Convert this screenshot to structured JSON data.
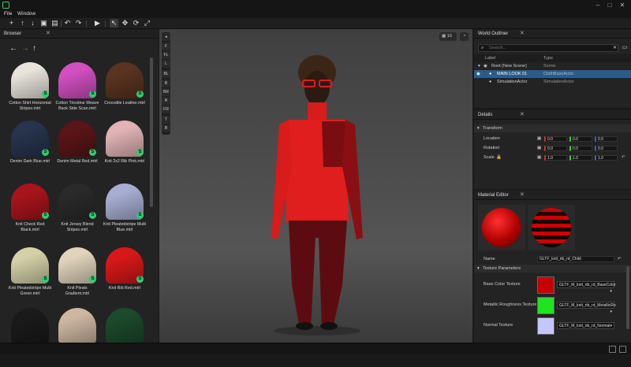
{
  "menu": {
    "file": "File",
    "window": "Window"
  },
  "browser": {
    "tab_label": "Browser",
    "items": [
      {
        "label": "Cotton Shirt Horizontal Stripes.mtrl",
        "color": "#e8e4dc"
      },
      {
        "label": "Cotton Tricotine Weave Back Side Scan.mtrl",
        "color": "#d24fc1"
      },
      {
        "label": "Crocodile Leather.mtrl",
        "color": "#5a3420"
      },
      {
        "label": "Denim Dark Blue.mtrl",
        "color": "#26344e"
      },
      {
        "label": "Denim Metal Red.mtrl",
        "color": "#5a1518"
      },
      {
        "label": "Knit 2x2 Rib Pink.mtrl",
        "color": "#e2b3b6"
      },
      {
        "label": "Knit Check Red Black.mtrl",
        "color": "#a8141c"
      },
      {
        "label": "Knit Jersey Blend Stripes.mtrl",
        "color": "#2a2a2a"
      },
      {
        "label": "Knit Pleatedstripe Multi Blue.mtrl",
        "color": "#a7aed2"
      },
      {
        "label": "Knit Pleatedstripe Multi Green.mtrl",
        "color": "#d4d0a8"
      },
      {
        "label": "Knit Pleats Gradient.mtrl",
        "color": "#e0d4bc"
      },
      {
        "label": "Knit Rib Red.mtrl",
        "color": "#d81818"
      },
      {
        "label": "",
        "color": "#1a1a1a"
      },
      {
        "label": "",
        "color": "#cdb7a1"
      },
      {
        "label": "",
        "color": "#1c4a2c"
      }
    ]
  },
  "viewport": {
    "count_value": "10",
    "side_tools": [
      "F",
      "FL",
      "L",
      "BL",
      "B",
      "BR",
      "R",
      "FR",
      "T",
      "B"
    ]
  },
  "outliner": {
    "tab_label": "World Outliner",
    "search_placeholder": "Search...",
    "col_label": "Label",
    "col_type": "Type",
    "rows": [
      {
        "label": "Root (New Scene)",
        "type": "Scene"
      },
      {
        "label": "MAIN LOOK 01",
        "type": "ClothBaseActor"
      },
      {
        "label": "SimulationActor",
        "type": "SimulationActor"
      }
    ]
  },
  "details": {
    "tab_label": "Details",
    "section": "Transform",
    "location_label": "Location",
    "rotation_label": "Rotation",
    "scale_label": "Scale",
    "location": [
      "0.0",
      "0.0",
      "0.0"
    ],
    "rotation": [
      "0.0",
      "0.0",
      "0.0"
    ],
    "scale": [
      "1.0",
      "1.0",
      "1.0"
    ]
  },
  "material_editor": {
    "tab_label": "Material Editor",
    "name_label": "Name",
    "name_value": "GLTF_knit_rib_rd_Child",
    "section": "Texture Parameters",
    "textures": [
      {
        "label": "Base Color Texture",
        "value": "GLTF_M_knit_rib_rd_BaseColor",
        "color": "#c40000"
      },
      {
        "label": "Metallic Roughness Texture",
        "value": "GLTF_M_knit_rib_rd_MetallicRo",
        "color": "#1fe51f"
      },
      {
        "label": "Normal Texture",
        "value": "GLTF_M_knit_rib_rd_Normal",
        "color": "#c6c6ff"
      }
    ]
  }
}
